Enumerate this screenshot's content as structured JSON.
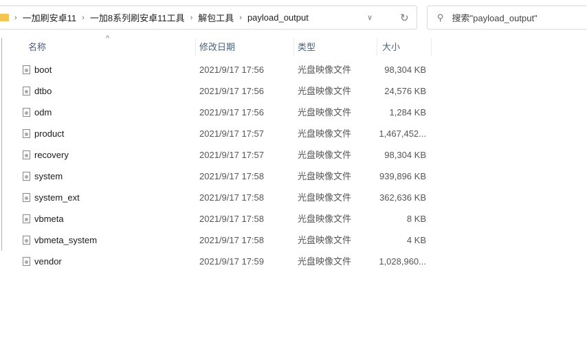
{
  "address": {
    "crumbs": [
      "一加刷安卓11",
      "一加8系列刷安卓11工具",
      "解包工具",
      "payload_output"
    ]
  },
  "search": {
    "placeholder": "搜索\"payload_output\""
  },
  "columns": {
    "name": "名称",
    "date": "修改日期",
    "type": "类型",
    "size": "大小"
  },
  "files": [
    {
      "name": "boot",
      "date": "2021/9/17 17:56",
      "type": "光盘映像文件",
      "size": "98,304 KB"
    },
    {
      "name": "dtbo",
      "date": "2021/9/17 17:56",
      "type": "光盘映像文件",
      "size": "24,576 KB"
    },
    {
      "name": "odm",
      "date": "2021/9/17 17:56",
      "type": "光盘映像文件",
      "size": "1,284 KB"
    },
    {
      "name": "product",
      "date": "2021/9/17 17:57",
      "type": "光盘映像文件",
      "size": "1,467,452..."
    },
    {
      "name": "recovery",
      "date": "2021/9/17 17:57",
      "type": "光盘映像文件",
      "size": "98,304 KB"
    },
    {
      "name": "system",
      "date": "2021/9/17 17:58",
      "type": "光盘映像文件",
      "size": "939,896 KB"
    },
    {
      "name": "system_ext",
      "date": "2021/9/17 17:58",
      "type": "光盘映像文件",
      "size": "362,636 KB"
    },
    {
      "name": "vbmeta",
      "date": "2021/9/17 17:58",
      "type": "光盘映像文件",
      "size": "8 KB"
    },
    {
      "name": "vbmeta_system",
      "date": "2021/9/17 17:58",
      "type": "光盘映像文件",
      "size": "4 KB"
    },
    {
      "name": "vendor",
      "date": "2021/9/17 17:59",
      "type": "光盘映像文件",
      "size": "1,028,960..."
    }
  ]
}
